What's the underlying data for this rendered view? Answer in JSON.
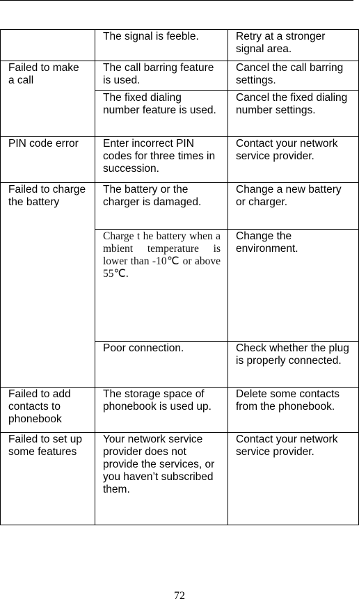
{
  "page": {
    "page_number": "72"
  },
  "table": {
    "rows": [
      {
        "problem": "",
        "cause": "The signal is feeble.",
        "solution": "Retry at a stronger signal area."
      },
      {
        "problem": "Failed to make a call",
        "cause": "The call barring feature is used.",
        "solution": "Cancel the call barring settings."
      },
      {
        "cause": "The fixed dialing number feature is used.",
        "solution": "Cancel the fixed dialing number settings."
      },
      {
        "problem": "PIN code error",
        "cause": "Enter incorrect PIN codes for three times in succession.",
        "solution": "Contact your network service provider."
      },
      {
        "problem": "Failed to charge the battery",
        "cause": "The battery or the charger is damaged.",
        "solution": "Change a new battery or charger."
      },
      {
        "cause": "Charge t he  battery when a     mbient temperature is lower   than -10℃ or above 55℃.",
        "solution": "Change the environment."
      },
      {
        "cause": "Poor connection.",
        "solution": "Check whether the plug is properly connected."
      },
      {
        "problem": "Failed to add contacts to phonebook",
        "cause": "The storage space of phonebook is used up.",
        "solution": "Delete some contacts from the phonebook."
      },
      {
        "problem": "Failed to set up some features",
        "cause": "Your network service provider does not provide the services, or you haven’t subscribed them.",
        "solution": "Contact your network service provider."
      }
    ]
  }
}
